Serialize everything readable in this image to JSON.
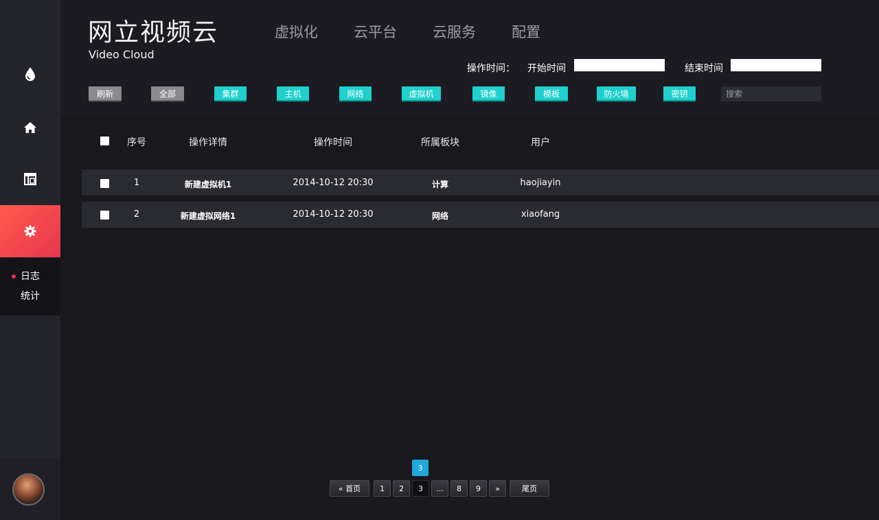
{
  "brand": {
    "title": "网立视频云",
    "subtitle": "Video Cloud"
  },
  "topnav": [
    "虚拟化",
    "云平台",
    "云服务",
    "配置"
  ],
  "timefilter": {
    "label": "操作时间：",
    "start_label": "开始时间",
    "start_value": "",
    "end_label": "结束时间",
    "end_value": ""
  },
  "filters": {
    "refresh": "刷新",
    "all": "全部",
    "categories": [
      "集群",
      "主机",
      "网络",
      "虚拟机",
      "镜像",
      "模板",
      "防火墙",
      "密钥"
    ]
  },
  "search": {
    "placeholder": "搜索"
  },
  "sidebar": {
    "icons": [
      "drop-icon",
      "home-icon",
      "layout-icon",
      "gear-icon"
    ],
    "active": "gear-icon",
    "submenu": [
      "日志",
      "统计"
    ],
    "active_submenu": "日志"
  },
  "table": {
    "headers": [
      "序号",
      "操作详情",
      "操作时间",
      "所属板块",
      "用户"
    ],
    "rows": [
      {
        "index": "1",
        "detail": "新建虚拟机1",
        "time": "2014-10-12 20:30",
        "module": "计算",
        "user": "haojiayin"
      },
      {
        "index": "2",
        "detail": "新建虚拟网络1",
        "time": "2014-10-12 20:30",
        "module": "网络",
        "user": "xiaofang"
      }
    ]
  },
  "pagination": {
    "current_badge": "3",
    "first": "« 首页",
    "pages": [
      "1",
      "2",
      "3",
      "...",
      "8",
      "9"
    ],
    "next": "»",
    "last": "尾页",
    "current": "3"
  },
  "colors": {
    "accent_cyan": "#1fd0cc",
    "accent_red": "#e8364f",
    "page_blue": "#1fa8d8",
    "background": "#1b1b21"
  }
}
